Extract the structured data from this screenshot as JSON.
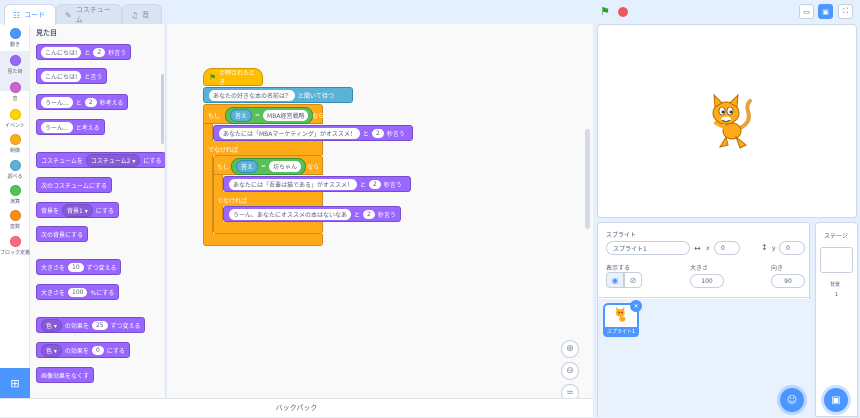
{
  "tabs": [
    {
      "label": "コード",
      "icon": "code-icon"
    },
    {
      "label": "コスチューム",
      "icon": "brush-icon"
    },
    {
      "label": "音",
      "icon": "speaker-icon"
    }
  ],
  "categories": [
    {
      "label": "動き",
      "color": "#4c97ff"
    },
    {
      "label": "見た目",
      "color": "#9966ff"
    },
    {
      "label": "音",
      "color": "#cf63cf"
    },
    {
      "label": "イベント",
      "color": "#ffd500"
    },
    {
      "label": "制御",
      "color": "#ffab19"
    },
    {
      "label": "調べる",
      "color": "#5cb1d6"
    },
    {
      "label": "演算",
      "color": "#59c059"
    },
    {
      "label": "変数",
      "color": "#ff8c1a"
    },
    {
      "label": "ブロック定義",
      "color": "#ff6680"
    }
  ],
  "palette": {
    "title": "見た目",
    "blocks": [
      {
        "parts": [
          "こんにちは!",
          "と",
          "2",
          "秒言う"
        ]
      },
      {
        "parts": [
          "こんにちは!",
          "と言う"
        ]
      },
      {
        "parts": [
          "うーん...",
          "と",
          "2",
          "秒考える"
        ]
      },
      {
        "parts": [
          "うーん...",
          "と考える"
        ]
      },
      {
        "parts": [
          "コスチュームを",
          "コスチューム2 ▾",
          "にする"
        ]
      },
      {
        "parts": [
          "次のコスチュームにする"
        ]
      },
      {
        "parts": [
          "背景を",
          "背景1 ▾",
          "にする"
        ]
      },
      {
        "parts": [
          "次の背景にする"
        ]
      },
      {
        "parts": [
          "大きさを",
          "10",
          "ずつ変える"
        ]
      },
      {
        "parts": [
          "大きさを",
          "100",
          "%にする"
        ]
      },
      {
        "parts": [
          "色 ▾",
          "の効果を",
          "25",
          "ずつ変える"
        ]
      },
      {
        "parts": [
          "色 ▾",
          "の効果を",
          "0",
          "にする"
        ]
      },
      {
        "parts": [
          "画像効果をなくす"
        ]
      }
    ]
  },
  "script": {
    "hat": "が押されたとき",
    "ask_text": "あなたの好きな本の名前は？",
    "ask_suffix": "と聞いて待つ",
    "if1": "もし",
    "then1": "なら",
    "answer1": "答え",
    "eq1": "=",
    "value1": "MBA経営戦略",
    "say1_text": "あなたには「MBAマーケティング」がオススメ！",
    "say1_and": "と",
    "say1_secs": "2",
    "say1_suffix": "秒言う",
    "else1": "でなければ",
    "if2": "もし",
    "then2": "なら",
    "answer2": "答え",
    "eq2": "=",
    "value2": "坊ちゃん",
    "say2_text": "あなたには「吾輩は猫である」がオススメ！",
    "say2_and": "と",
    "say2_secs": "2",
    "say2_suffix": "秒言う",
    "else2": "でなければ",
    "say3_text": "うーん、あなたにオススメの本はないなあ",
    "say3_and": "と",
    "say3_secs": "2",
    "say3_suffix": "秒言う"
  },
  "backpack": "バックパック",
  "sprite_info": {
    "sprite_label": "スプライト",
    "sprite_name": "スプライト1",
    "x_label": "x",
    "x_value": "0",
    "y_label": "y",
    "y_value": "0",
    "show_label": "表示する",
    "size_label": "大きさ",
    "size_value": "100",
    "direction_label": "向き",
    "direction_value": "90"
  },
  "sprites": [
    {
      "name": "スプライト1"
    }
  ],
  "stage_panel": {
    "title": "ステージ",
    "backdrops_label": "背景",
    "backdrops_count": "1"
  }
}
